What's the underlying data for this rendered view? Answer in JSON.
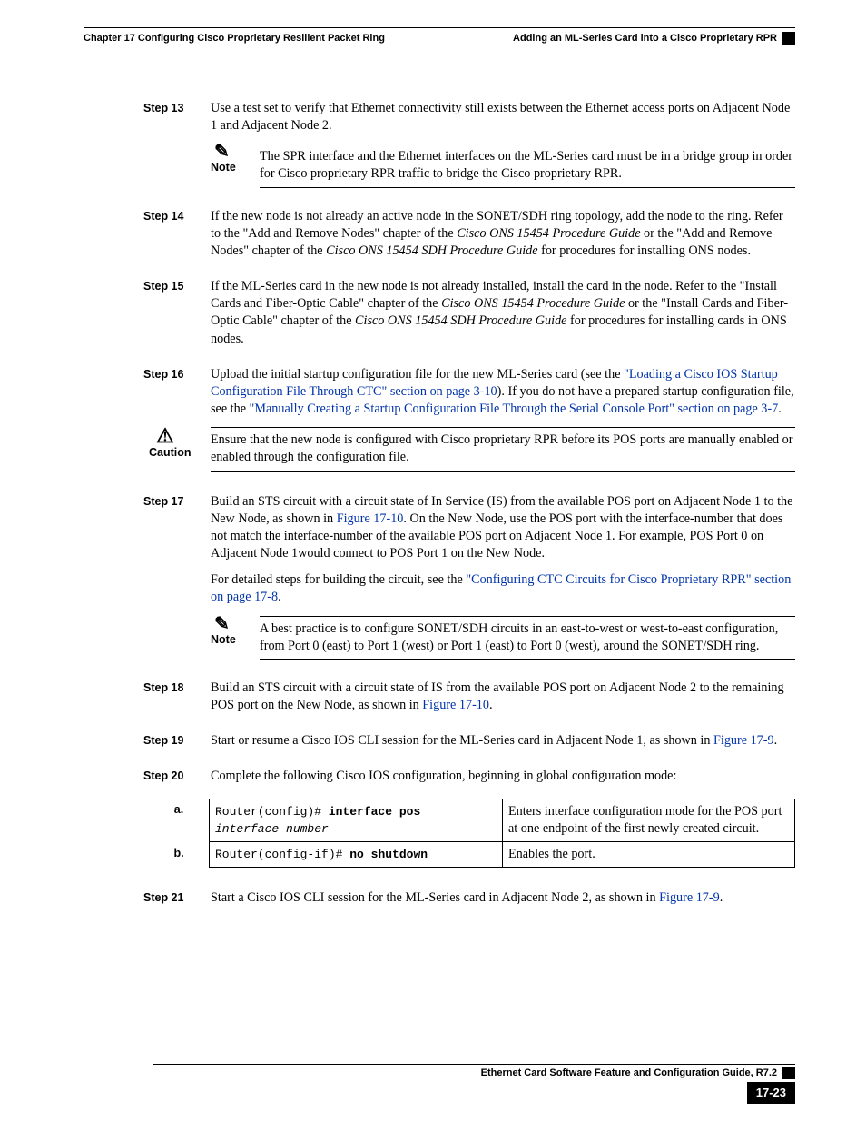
{
  "header": {
    "chapter_line": "Chapter 17 Configuring Cisco Proprietary Resilient Packet Ring",
    "section_line": "Adding an ML-Series Card into a Cisco Proprietary RPR"
  },
  "steps": {
    "s13": {
      "label": "Step 13",
      "t1": "Use a test set to verify that Ethernet connectivity still exists between the Ethernet access ports on Adjacent Node 1 and Adjacent Node 2."
    },
    "note13": {
      "label": "Note",
      "text": "The SPR interface and the Ethernet interfaces on the ML-Series card must be in a bridge group in order for Cisco proprietary RPR traffic to bridge the Cisco proprietary RPR."
    },
    "s14": {
      "label": "Step 14",
      "t1a": "If the new node is not already an active node in the SONET/SDH ring topology, add the node to the ring. Refer to the \"Add and Remove Nodes\" chapter of the ",
      "g1": "Cisco ONS 15454 Procedure Guide",
      "t1b": " or the \"Add and Remove Nodes\" chapter of the ",
      "g2": "Cisco ONS 15454 SDH Procedure Guide",
      "t1c": " for procedures for installing ONS nodes."
    },
    "s15": {
      "label": "Step 15",
      "t1a": "If the ML-Series card in the new node is not already installed, install the card in the node. Refer to the \"Install Cards and Fiber-Optic Cable\" chapter of the ",
      "g1": "Cisco ONS 15454 Procedure Guide",
      "t1b": " or the \"Install Cards and Fiber-Optic Cable\" chapter of the ",
      "g2": "Cisco ONS 15454 SDH Procedure Guide",
      "t1c": " for procedures for installing cards in ONS nodes."
    },
    "s16": {
      "label": "Step 16",
      "t1a": "Upload the initial startup configuration file for the new ML-Series card (see the ",
      "link1": "\"Loading a Cisco IOS Startup Configuration File Through CTC\" section on page 3-10",
      "t1b": "). If you do not have a prepared startup configuration file, see the ",
      "link2": "\"Manually Creating a Startup Configuration File Through the Serial Console Port\" section on page 3-7",
      "t1c": "."
    },
    "caution16": {
      "label": "Caution",
      "text": "Ensure that the new node is configured with Cisco proprietary RPR before its POS ports are manually enabled or enabled through the configuration file."
    },
    "s17": {
      "label": "Step 17",
      "t1a": "Build an STS circuit with a circuit state of In Service (IS) from the available POS port on Adjacent Node 1 to the New Node, as shown in ",
      "link1": "Figure 17-10",
      "t1b": ". On the New Node, use the POS port with the interface-number that does not match the interface-number of the available POS port on Adjacent Node 1. For example, POS Port 0 on Adjacent Node 1would connect to POS Port 1 on the New Node.",
      "t2a": "For detailed steps for building the circuit, see the ",
      "link2": "\"Configuring CTC Circuits for Cisco Proprietary RPR\" section on page 17-8",
      "t2b": "."
    },
    "note17": {
      "label": "Note",
      "text": "A best practice is to configure SONET/SDH circuits in an east-to-west or west-to-east configuration, from Port 0 (east) to Port 1 (west) or Port 1 (east) to Port 0 (west), around the SONET/SDH ring."
    },
    "s18": {
      "label": "Step 18",
      "t1a": "Build an STS circuit with a circuit state of IS from the available POS port on Adjacent Node 2 to the remaining POS port on the New Node, as shown in ",
      "link1": "Figure 17-10",
      "t1b": "."
    },
    "s19": {
      "label": "Step 19",
      "t1a": "Start or resume a Cisco IOS CLI session for the ML-Series card in Adjacent Node 1, as shown in ",
      "link1": "Figure 17-9",
      "t1b": "."
    },
    "s20": {
      "label": "Step 20",
      "t1": "Complete the following Cisco IOS configuration, beginning in global configuration mode:"
    },
    "table20": {
      "rows": [
        {
          "id": "a.",
          "cmd_pre": "Router(config)# ",
          "cmd_bold": "interface pos",
          "cmd_arg": "interface-number",
          "desc": "Enters interface configuration mode for the POS port at one endpoint of the first newly created circuit."
        },
        {
          "id": "b.",
          "cmd_pre": "Router(config-if)# ",
          "cmd_bold": "no shutdown",
          "cmd_arg": "",
          "desc": "Enables the port."
        }
      ]
    },
    "s21": {
      "label": "Step 21",
      "t1a": "Start a Cisco IOS CLI session for the ML-Series card in Adjacent Node 2, as shown in ",
      "link1": "Figure 17-9",
      "t1b": "."
    }
  },
  "footer": {
    "guide": "Ethernet Card Software Feature and Configuration Guide, R7.2",
    "page": "17-23"
  }
}
